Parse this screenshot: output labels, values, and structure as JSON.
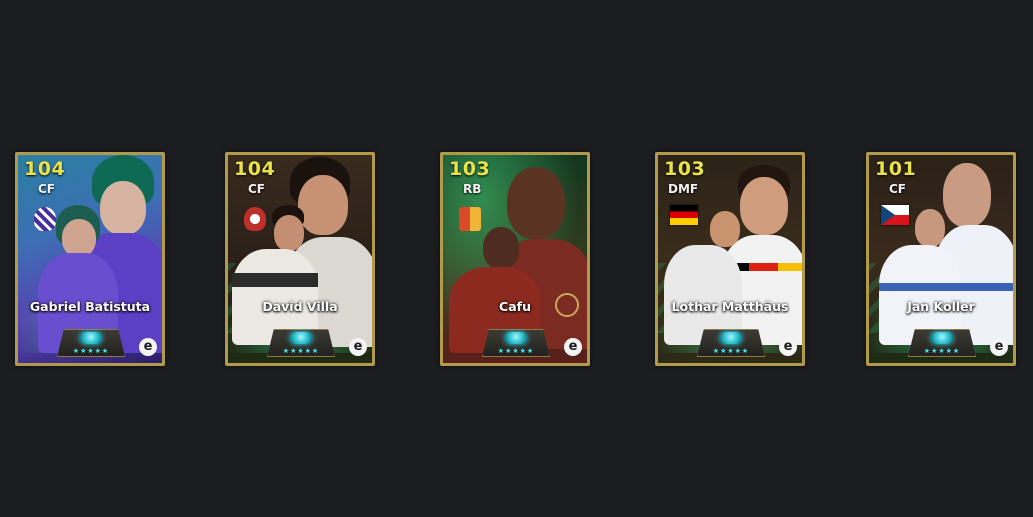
{
  "cards": [
    {
      "rating": "104",
      "position": "CF",
      "name": "Gabriel Batistuta",
      "badge_icon": "fiorentina-club-badge",
      "brand": "e"
    },
    {
      "rating": "104",
      "position": "CF",
      "name": "David Villa",
      "badge_icon": "club-crest-badge",
      "brand": "e"
    },
    {
      "rating": "103",
      "position": "RB",
      "name": "Cafu",
      "badge_icon": "club-crest-badge",
      "brand": "e"
    },
    {
      "rating": "103",
      "position": "DMF",
      "name": "Lothar Matthäus",
      "badge_icon": "germany-flag",
      "brand": "e"
    },
    {
      "rating": "101",
      "position": "CF",
      "name": "Jan Koller",
      "badge_icon": "czech-flag",
      "brand": "e"
    }
  ],
  "stars": "★★★★★",
  "colors": {
    "background": "#1c1d21",
    "card_border": "#b29a4d",
    "rating": "#e9e24b",
    "accent": "#46e6f0"
  }
}
